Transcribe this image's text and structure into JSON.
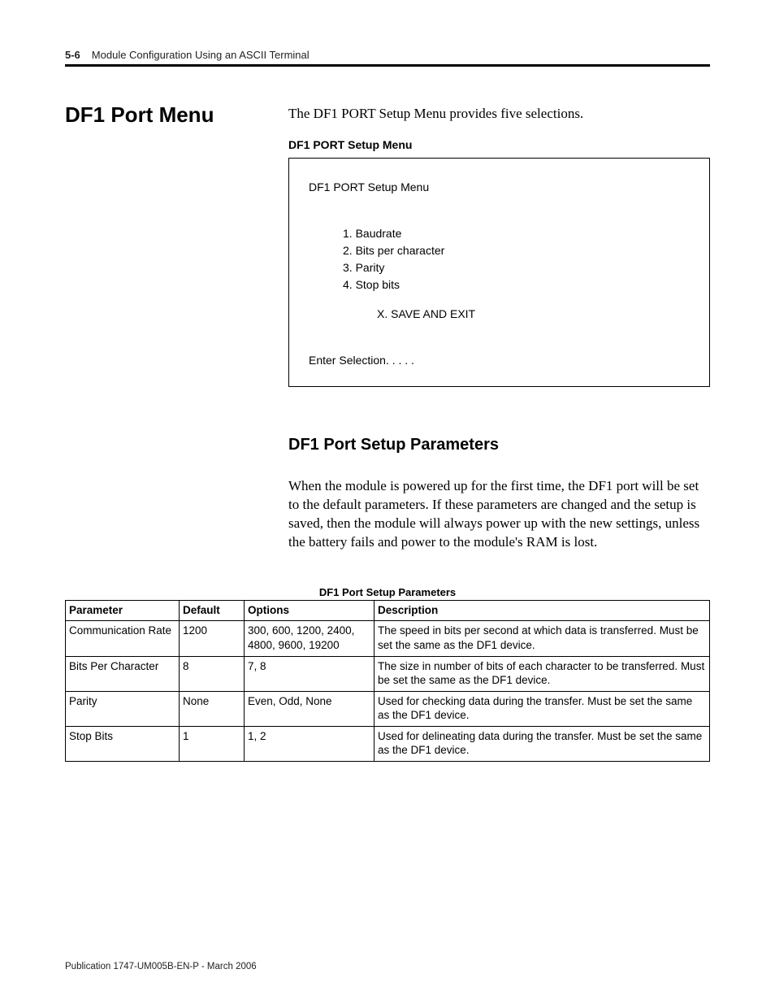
{
  "header": {
    "page_number": "5-6",
    "chapter_title": "Module Configuration Using an ASCII Terminal"
  },
  "section_title": "DF1 Port Menu",
  "intro_text": "The DF1 PORT Setup Menu provides five selections.",
  "menu_box_label": "DF1 PORT Setup Menu",
  "menu": {
    "title": "DF1  PORT Setup Menu",
    "items": [
      "1. Baudrate",
      "2. Bits per character",
      "3. Parity",
      "4. Stop bits"
    ],
    "exit": "X. SAVE AND EXIT",
    "prompt": "Enter Selection. . . . ."
  },
  "subsection_title": "DF1 Port Setup Parameters",
  "subsection_body": "When the module is powered up for the first time, the DF1 port will be set to the default parameters. If these parameters are changed and the setup is saved, then the module will always power up with the new settings, unless the battery fails and power to the module's RAM is lost.",
  "table_caption": "DF1 Port Setup Parameters",
  "table": {
    "headers": {
      "parameter": "Parameter",
      "default_": "Default",
      "options": "Options",
      "description": "Description"
    },
    "rows": [
      {
        "parameter": "Communication Rate",
        "default_": "1200",
        "options": "300, 600, 1200, 2400, 4800, 9600, 19200",
        "description": "The speed in bits per second at which data is transferred. Must be set the same as the DF1 device."
      },
      {
        "parameter": "Bits Per Character",
        "default_": "8",
        "options": "7, 8",
        "description": "The size in number of bits of each character to be transferred. Must be set the same as the DF1 device."
      },
      {
        "parameter": "Parity",
        "default_": "None",
        "options": "Even, Odd, None",
        "description": "Used for checking data during the transfer. Must be set the same as the DF1 device."
      },
      {
        "parameter": "Stop Bits",
        "default_": "1",
        "options": "1, 2",
        "description": "Used for delineating data during the transfer. Must be set the same as the DF1 device."
      }
    ]
  },
  "footer": "Publication 1747-UM005B-EN-P - March 2006"
}
